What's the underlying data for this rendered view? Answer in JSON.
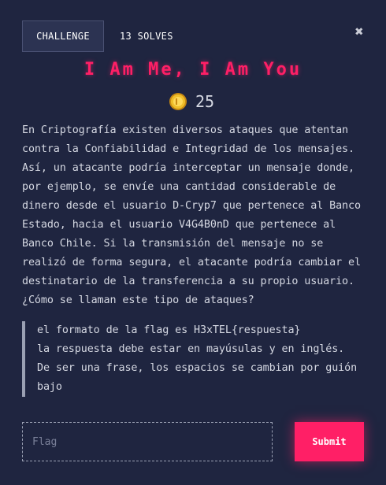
{
  "header": {
    "tab_label": "CHALLENGE",
    "solves_label": "13 SOLVES",
    "close_icon": "close-icon"
  },
  "challenge": {
    "title": "I Am Me, I Am You",
    "points": "25",
    "points_icon": "coin-icon",
    "description": "En Criptografía existen diversos ataques que atentan\ncontra la Confiabilidad e Integridad de los mensajes.\nAsí, un atacante podría interceptar un mensaje donde,\npor ejemplo, se envíe una cantidad considerable de\ndinero desde el usuario D-Cryp7 que pertenece al Banco\nEstado, hacia el usuario V4G4B0nD que pertenece al\nBanco Chile. Si la transmisión del mensaje no se\nrealizó de forma segura, el atacante podría cambiar el\ndestinatario de la transferencia a su propio usuario.\n¿Cómo se llaman este tipo de ataques?",
    "note_lines": [
      "el formato de la flag es H3xTEL{respuesta}",
      "la respuesta debe estar en mayúsulas y en inglés.",
      "De ser una frase, los espacios se cambian por guión",
      "bajo"
    ]
  },
  "form": {
    "flag_placeholder": "Flag",
    "flag_value": "",
    "submit_label": "Submit"
  },
  "colors": {
    "background": "#1f2540",
    "accent": "#ff1f66",
    "text": "#d5d8e2",
    "coin": "#e8b422"
  }
}
